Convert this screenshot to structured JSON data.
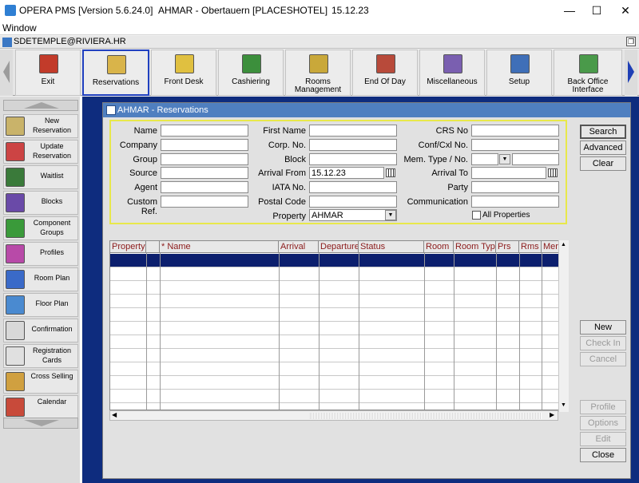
{
  "titlebar": {
    "app": "OPERA PMS [Version 5.6.24.0]",
    "property": "AHMAR - Obertauern [PLACESHOTEL]",
    "date": "15.12.23",
    "minimize": "—",
    "maximize": "☐",
    "close": "✕"
  },
  "menu": {
    "window": "Window"
  },
  "user": {
    "name": "SDETEMPLE@RIVIERA.HR"
  },
  "toolbar": {
    "buttons": [
      {
        "label": "Exit"
      },
      {
        "label": "Reservations"
      },
      {
        "label": "Front Desk"
      },
      {
        "label": "Cashiering"
      },
      {
        "label": "Rooms\nManagement"
      },
      {
        "label": "End Of Day"
      },
      {
        "label": "Miscellaneous"
      },
      {
        "label": "Setup"
      },
      {
        "label": "Back Office\nInterface"
      }
    ]
  },
  "nav": {
    "items": [
      {
        "label": "New\nReservation"
      },
      {
        "label": "Update\nReservation"
      },
      {
        "label": "Waitlist"
      },
      {
        "label": "Blocks"
      },
      {
        "label": "Component\nGroups"
      },
      {
        "label": "Profiles"
      },
      {
        "label": "Room Plan"
      },
      {
        "label": "Floor Plan"
      },
      {
        "label": "Confirmation"
      },
      {
        "label": "Registration\nCards"
      },
      {
        "label": "Cross Selling"
      },
      {
        "label": "Calendar"
      }
    ]
  },
  "window": {
    "title": "AHMAR - Reservations"
  },
  "search": {
    "name": "Name",
    "company": "Company",
    "group": "Group",
    "source": "Source",
    "agent": "Agent",
    "custom_ref": "Custom Ref.",
    "first_name": "First Name",
    "corp_no": "Corp. No.",
    "block": "Block",
    "arrival_from": "Arrival From",
    "arrival_from_value": "15.12.23",
    "iata_no": "IATA No.",
    "postal_code": "Postal Code",
    "property": "Property",
    "property_value": "AHMAR",
    "crs_no": "CRS No",
    "conf_cxl_no": "Conf/Cxl No.",
    "mem_type_no": "Mem. Type / No.",
    "arrival_to": "Arrival To",
    "party": "Party",
    "communication": "Communication",
    "all_properties": "All Properties"
  },
  "grid": {
    "columns": [
      "Property",
      "",
      "* Name",
      "Arrival",
      "Departure",
      "Status",
      "Room",
      "Room Type",
      "Prs",
      "Rms",
      "Mem"
    ]
  },
  "buttons": {
    "search": "Search",
    "advanced": "Advanced",
    "clear": "Clear",
    "new": "New",
    "check_in": "Check In",
    "cancel": "Cancel",
    "profile": "Profile",
    "options": "Options",
    "edit": "Edit",
    "close": "Close"
  },
  "colors": {
    "mdi_background": "#0e2c7e",
    "window_title": "#4f7fc0",
    "search_border": "#e8e84a",
    "selected_row": "#0c1f6e",
    "column_header_text": "#8b1a1a"
  }
}
